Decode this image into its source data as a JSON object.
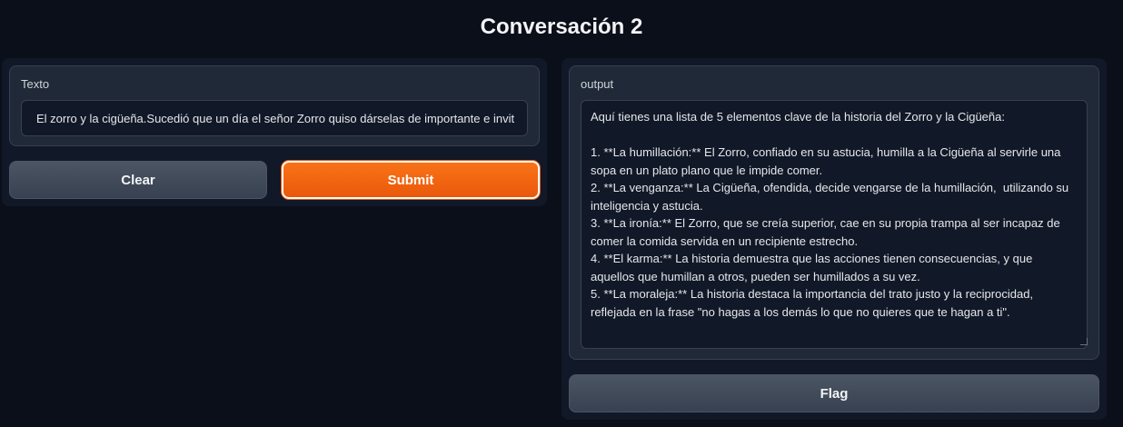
{
  "page": {
    "title": "Conversación 2"
  },
  "input": {
    "label": "Texto",
    "value": "El zorro y la cigüeña.Sucedió que un día el señor Zorro quiso dárselas de importante e invit"
  },
  "buttons": {
    "clear": "Clear",
    "submit": "Submit",
    "flag": "Flag"
  },
  "output": {
    "label": "output",
    "value": "Aquí tienes una lista de 5 elementos clave de la historia del Zorro y la Cigüeña:\n\n1. **La humillación:** El Zorro, confiado en su astucia, humilla a la Cigüeña al servirle una sopa en un plato plano que le impide comer.\n2. **La venganza:** La Cigüeña, ofendida, decide vengarse de la humillación,  utilizando su inteligencia y astucia.\n3. **La ironía:** El Zorro, que se creía superior, cae en su propia trampa al ser incapaz de comer la comida servida en un recipiente estrecho.\n4. **El karma:** La historia demuestra que las acciones tienen consecuencias, y que aquellos que humillan a otros, pueden ser humillados a su vez.\n5. **La moraleja:** La historia destaca la importancia del trato justo y la reciprocidad, reflejada en la frase \"no hagas a los demás lo que no quieres que te hagan a ti\"."
  }
}
